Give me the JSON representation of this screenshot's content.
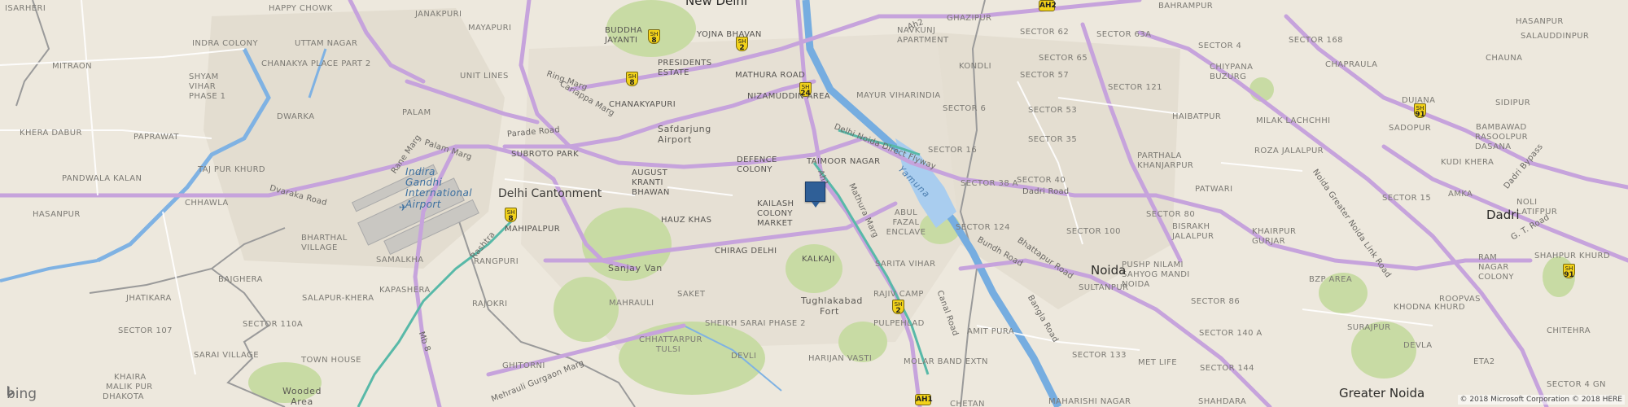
{
  "map": {
    "district_labels": [
      "ISARHERI",
      "HAPPY CHOWK",
      "JANAKPURI",
      "INDRA COLONY",
      "UTTAM NAGAR",
      "MITRAON",
      "CHANAKYA PLACE PART 2",
      "UNIT LINES",
      "SHYAM VIHAR PHASE 1",
      "DWARKA",
      "PALAM",
      "KHERA DABUR",
      "PAPRAWAT",
      "TAJ PUR KHURD",
      "PANDWALA KALAN",
      "CHHAWLA",
      "HASANPUR",
      "BHARTHAL VILLAGE",
      "SAMALKHA",
      "BAJGHERA",
      "KAPASHERA",
      "JHATIKARA",
      "RAJOKRI",
      "SALAPUR-KHERA",
      "SECTOR 107",
      "SECTOR 110A",
      "SARAI VILLAGE",
      "TOWN HOUSE",
      "KHAIRA",
      "MALIK PUR",
      "DHAKOTA",
      "GHITORNI",
      "MAYAPURI",
      "BUDDHA JAYANTI",
      "YOJNA BHAVAN",
      "PRESIDENTS ESTATE",
      "MATHURA ROAD",
      "CHANAKYAPURI",
      "SUBROTO PARK",
      "NIZAMUDDIN AREA",
      "DEFENCE COLONY",
      "AUGUST KRANTI BHAWAN",
      "HAUZ KHAS",
      "KAILASH COLONY MARKET",
      "CHIRAG DELHI",
      "TAIMOOR NAGAR",
      "KALKAJI",
      "MAHIPALPUR",
      "RANGPURI",
      "MAHRAULI",
      "SAKET",
      "SHEIKH SARAI PHASE 2",
      "CHHATTARPUR TULSI",
      "DEVLI",
      "HARIJAN VASTI",
      "PULPEHLAD",
      "RAJIV CAMP",
      "SARITA VIHAR",
      "ABUL FAZAL ENCLAVE",
      "AMIT PURA",
      "MOLAR BAND EXTN",
      "NAVKUNJ APARTMENT",
      "GHAZIPUR",
      "MAYUR VIHARINDIA",
      "KONDLI",
      "SECTOR 6",
      "SECTOR 16",
      "SECTOR 38 A",
      "SECTOR 124",
      "SECTOR 62",
      "SECTOR 63A",
      "SECTOR 65",
      "SECTOR 57",
      "SECTOR 53",
      "SECTOR 121",
      "SECTOR 35",
      "SECTOR 40",
      "SECTOR 4",
      "SECTOR 168",
      "CHIYPANA BUZURG",
      "CHAPRAULA",
      "HAIBATPUR",
      "MILAK LACHCHHI",
      "PARTHALA KHANJARPUR",
      "ROZA JALALPUR",
      "PATWARI",
      "SECTOR 15",
      "SECTOR 80",
      "SECTOR 100",
      "BISRAKH JALALPUR",
      "KHAIRPUR GURJAR",
      "PUSHP NILAMI SAHYOG MANDI NOIDA",
      "BZP AREA",
      "SECTOR 86",
      "SULTANPUR",
      "SECTOR 140 A",
      "MET LIFE",
      "SECTOR 144",
      "SECTOR 133",
      "MAHARISHI NAGAR",
      "SHAHDARA",
      "BAHRAMPUR",
      "SADOPUR",
      "BAMBAWAD",
      "KUDI KHERA",
      "DUJANA",
      "RASOOLPUR DASANA",
      "SIDIPUR",
      "CHAUNA",
      "SALAUDDINPUR",
      "AMKA",
      "NOLI LATIFPUR",
      "RAM NAGAR COLONY",
      "SHAHPUR KHURD",
      "ROOPVAS",
      "KHODNA KHURD",
      "CHITEHRA",
      "SURAJPUR",
      "DEVLA",
      "ETA2",
      "SECTOR 4 GN",
      "HASANPUR"
    ],
    "area_labels": [
      "Safdarjung Airport",
      "Sanjay Van",
      "Tughlakabad Fort",
      "Wooded Area",
      "CHETAN"
    ],
    "city_labels": [
      "New Delhi",
      "Delhi Cantonment",
      "Noida",
      "Dadri",
      "Greater Noida"
    ],
    "road_labels": [
      "Ring Marg",
      "Cariappa Marg",
      "Palam Marg",
      "Rane Marg",
      "Parade Road",
      "Dvaraka Road",
      "Mathura Marg",
      "Delhi Noida Direct Flyway",
      "Dadri Road",
      "Bundh Road",
      "Bhattapur Road",
      "Bangla Road",
      "Canal Road",
      "Noida Greater Noida Link Road",
      "Dadri Bypass",
      "G. T. Road",
      "Mehrauli Gurgaon Marg",
      "Mb 8",
      "Rashtra",
      "Ah2",
      "Ah1"
    ],
    "water_labels": [
      "Yamuna"
    ],
    "airport_label": "Indira Gandhi International Airport",
    "shields": [
      {
        "id": "SH 8",
        "top": "SH",
        "num": "8"
      },
      {
        "id": "SH 2",
        "top": "SH",
        "num": "2"
      },
      {
        "id": "SH 24",
        "top": "SH",
        "num": "24"
      },
      {
        "id": "AH2",
        "top": "",
        "num": "AH2"
      },
      {
        "id": "AH1",
        "top": "",
        "num": "AH1"
      },
      {
        "id": "SH 91",
        "top": "SH",
        "num": "91"
      }
    ],
    "marker": {
      "name": "location-pin",
      "color": "#2f5f97"
    }
  },
  "branding": {
    "logo_text": "bing",
    "copyright": "© 2018 Microsoft Corporation © 2018 HERE"
  },
  "colors": {
    "land": "#ede8dd",
    "water": "#a9cdef",
    "river_blue": "#4d8fcf",
    "major_road": "#c4a1d9",
    "park": "#c8dba4",
    "urban": "#e2ddd2"
  }
}
